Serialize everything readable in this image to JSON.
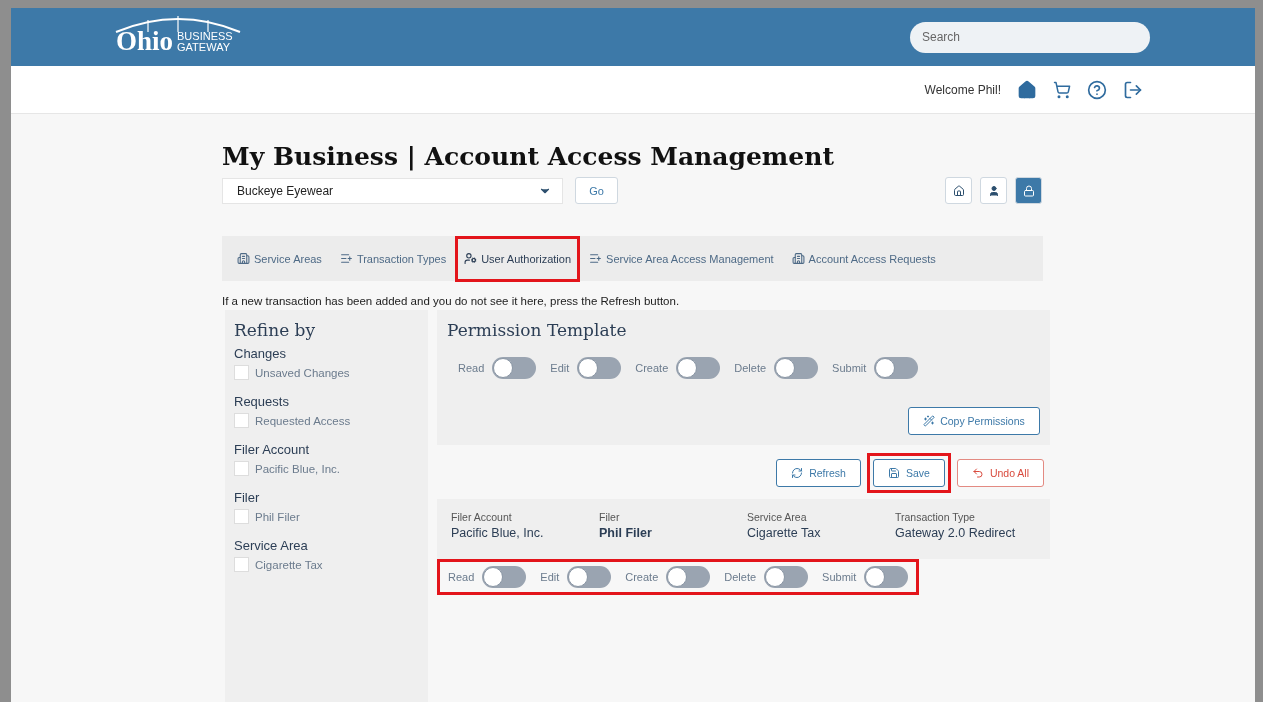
{
  "header": {
    "logo": {
      "main": "Ohio",
      "line_1": "BUSINESS",
      "line_2": "GATEWAY"
    },
    "search": {
      "placeholder": "Search"
    },
    "welcome": "Welcome Phil!"
  },
  "page": {
    "title": "My Business | Account Access Management",
    "business_select": {
      "value": "Buckeye Eyewear"
    },
    "go_button": "Go",
    "view_buttons": [
      {
        "kind": "home",
        "selected": false
      },
      {
        "kind": "user",
        "selected": false
      },
      {
        "kind": "lock",
        "selected": true
      }
    ]
  },
  "tabs": [
    {
      "label": "Service Areas",
      "kind": "building",
      "selected": false,
      "highlighted": false
    },
    {
      "label": "Transaction Types",
      "kind": "list",
      "selected": false,
      "highlighted": false
    },
    {
      "label": "User Authorization",
      "kind": "user",
      "selected": true,
      "highlighted": true
    },
    {
      "label": "Service Area Access Management",
      "kind": "list",
      "selected": false,
      "highlighted": false
    },
    {
      "label": "Account Access Requests",
      "kind": "building",
      "selected": false,
      "highlighted": false
    }
  ],
  "info": "If a new transaction has been added and you do not see it here, press the Refresh button.",
  "refine": {
    "title": "Refine by",
    "groups": [
      {
        "heading": "Changes",
        "options": [
          {
            "label": "Unsaved Changes",
            "checked": false
          }
        ]
      },
      {
        "heading": "Requests",
        "options": [
          {
            "label": "Requested Access",
            "checked": false
          }
        ]
      },
      {
        "heading": "Filer Account",
        "options": [
          {
            "label": "Pacific Blue, Inc.",
            "checked": false
          }
        ]
      },
      {
        "heading": "Filer",
        "options": [
          {
            "label": "Phil Filer",
            "checked": false
          }
        ]
      },
      {
        "heading": "Service Area",
        "options": [
          {
            "label": "Cigarette Tax",
            "checked": false
          }
        ]
      }
    ]
  },
  "template": {
    "title": "Permission Template",
    "toggles": [
      {
        "label": "Read",
        "on": false
      },
      {
        "label": "Edit",
        "on": false
      },
      {
        "label": "Create",
        "on": false
      },
      {
        "label": "Delete",
        "on": false
      },
      {
        "label": "Submit",
        "on": false
      }
    ],
    "copy_button": "Copy Permissions"
  },
  "actions": [
    {
      "label": "Refresh",
      "kind": "refresh",
      "highlighted": false
    },
    {
      "label": "Save",
      "kind": "save",
      "highlighted": true
    },
    {
      "label": "Undo All",
      "kind": "undo",
      "highlighted": false
    }
  ],
  "record": {
    "fields": [
      {
        "label": "Filer Account",
        "value": "Pacific Blue, Inc.",
        "bold": false
      },
      {
        "label": "Filer",
        "value": "Phil Filer",
        "bold": true
      },
      {
        "label": "Service Area",
        "value": "Cigarette Tax",
        "bold": false
      },
      {
        "label": "Transaction Type",
        "value": "Gateway 2.0 Redirect",
        "bold": false
      }
    ],
    "highlighted": true,
    "toggles": [
      {
        "label": "Read",
        "on": false
      },
      {
        "label": "Edit",
        "on": false
      },
      {
        "label": "Create",
        "on": false
      },
      {
        "label": "Delete",
        "on": false
      },
      {
        "label": "Submit",
        "on": false
      }
    ]
  }
}
